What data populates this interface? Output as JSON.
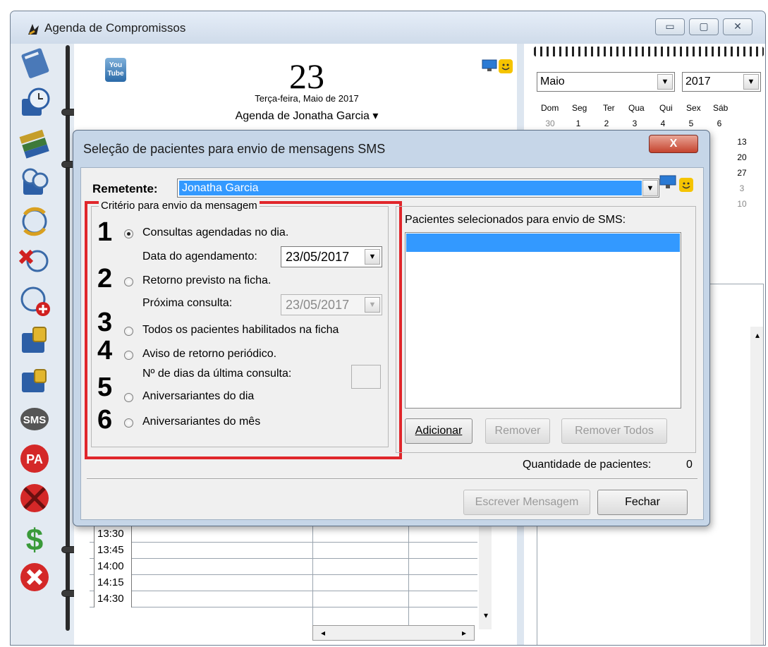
{
  "main_window": {
    "title": "Agenda de Compromissos",
    "controls": {
      "minimize": "▭",
      "maximize": "▢",
      "close": "✕"
    }
  },
  "day_view": {
    "day_number": "23",
    "date_text": "Terça-feira, Maio de 2017",
    "agenda_owner": "Agenda de Jonatha Garcia ▾",
    "youtube_label": "You Tube"
  },
  "timetable": {
    "times": [
      "13:30",
      "13:45",
      "14:00",
      "14:15",
      "14:30"
    ]
  },
  "calendar": {
    "month": "Maio",
    "year": "2017",
    "weekdays": [
      "Dom",
      "Seg",
      "Ter",
      "Qua",
      "Qui",
      "Sex",
      "Sáb"
    ],
    "first_row": [
      "30",
      "1",
      "2",
      "3",
      "4",
      "5",
      "6"
    ],
    "right_column": [
      "13",
      "20",
      "27",
      "3",
      "10"
    ]
  },
  "sidebar": {
    "sms_label": "SMS",
    "pa_label": "PA"
  },
  "dialog": {
    "title": "Seleção de pacientes para envio de mensagens SMS",
    "close": "X",
    "sender_label": "Remetente:",
    "sender_value": "Jonatha Garcia",
    "criteria_legend": "Critério para envio da mensagem",
    "options": [
      {
        "number": "1",
        "label": "Consultas agendadas no dia.",
        "selected": true
      },
      {
        "number": "2",
        "label": "Retorno previsto na ficha.",
        "selected": false
      },
      {
        "number": "3",
        "label": "Todos os pacientes habilitados na ficha",
        "selected": false
      },
      {
        "number": "4",
        "label": "Aviso de retorno periódico.",
        "selected": false
      },
      {
        "number": "5",
        "label": "Aniversariantes do dia",
        "selected": false
      },
      {
        "number": "6",
        "label": "Aniversariantes do mês",
        "selected": false
      }
    ],
    "schedule_date_label": "Data do agendamento:",
    "schedule_date_value": "23/05/2017",
    "next_visit_label": "Próxima consulta:",
    "next_visit_value": "23/05/2017",
    "days_label": "Nº de dias da última consulta:",
    "selected_label": "Pacientes selecionados para envio de SMS:",
    "buttons": {
      "add": "Adicionar",
      "remove": "Remover",
      "remove_all": "Remover Todos",
      "write": "Escrever Mensagem",
      "close": "Fechar"
    },
    "quantity_label": "Quantidade de pacientes:",
    "quantity_value": "0"
  },
  "colors": {
    "selection": "#3399ff",
    "highlight_frame": "#e0262b",
    "dialog_frame": "#c6d6e8"
  }
}
